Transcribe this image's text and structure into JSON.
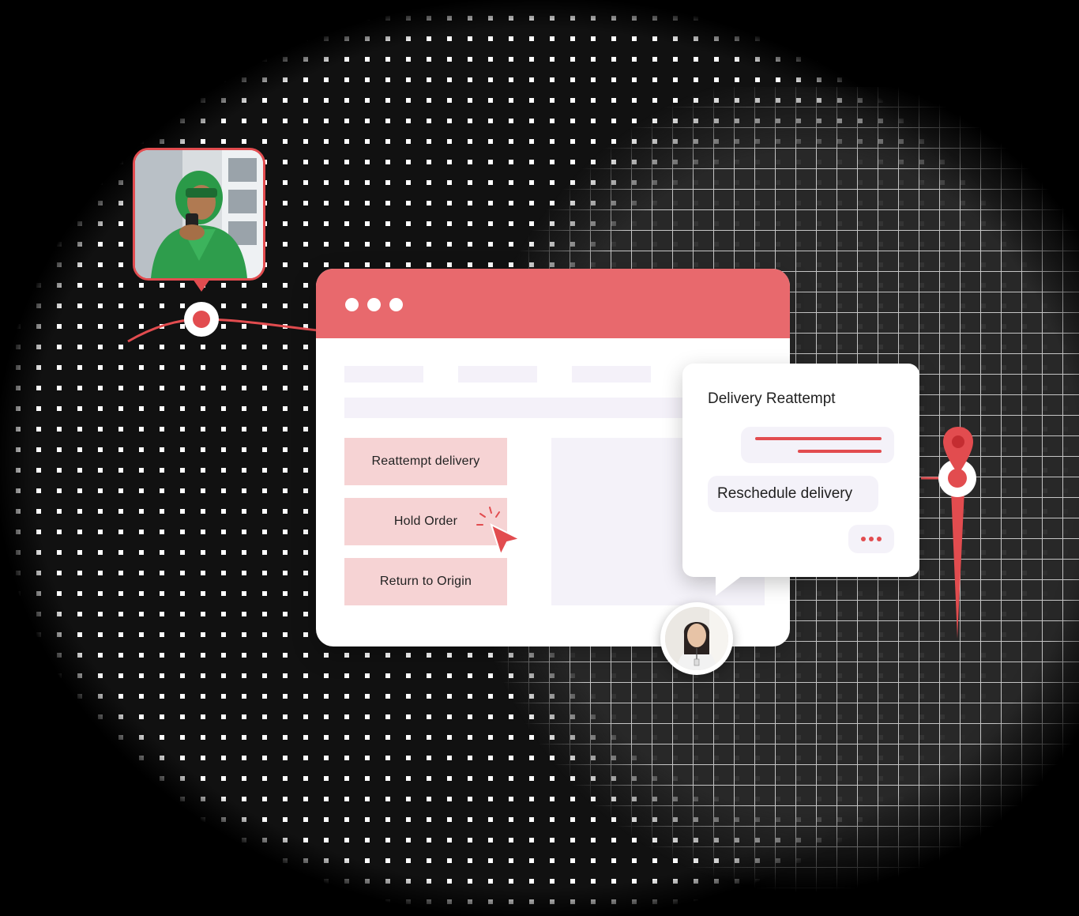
{
  "window": {
    "actions": [
      "Reattempt delivery",
      "Hold Order",
      "Return to Origin"
    ]
  },
  "chat": {
    "title": "Delivery Reattempt",
    "reschedule_label": "Reschedule delivery"
  },
  "colors": {
    "accent": "#e24c4f",
    "window_bar": "#e8696d",
    "action_bg": "#f6d3d4",
    "placeholder": "#f4f1f9"
  },
  "icons": [
    "rider-photo",
    "cursor-arrow-icon",
    "click-spark-icon",
    "map-pin-icon",
    "ellipsis-icon",
    "support-agent-avatar"
  ]
}
